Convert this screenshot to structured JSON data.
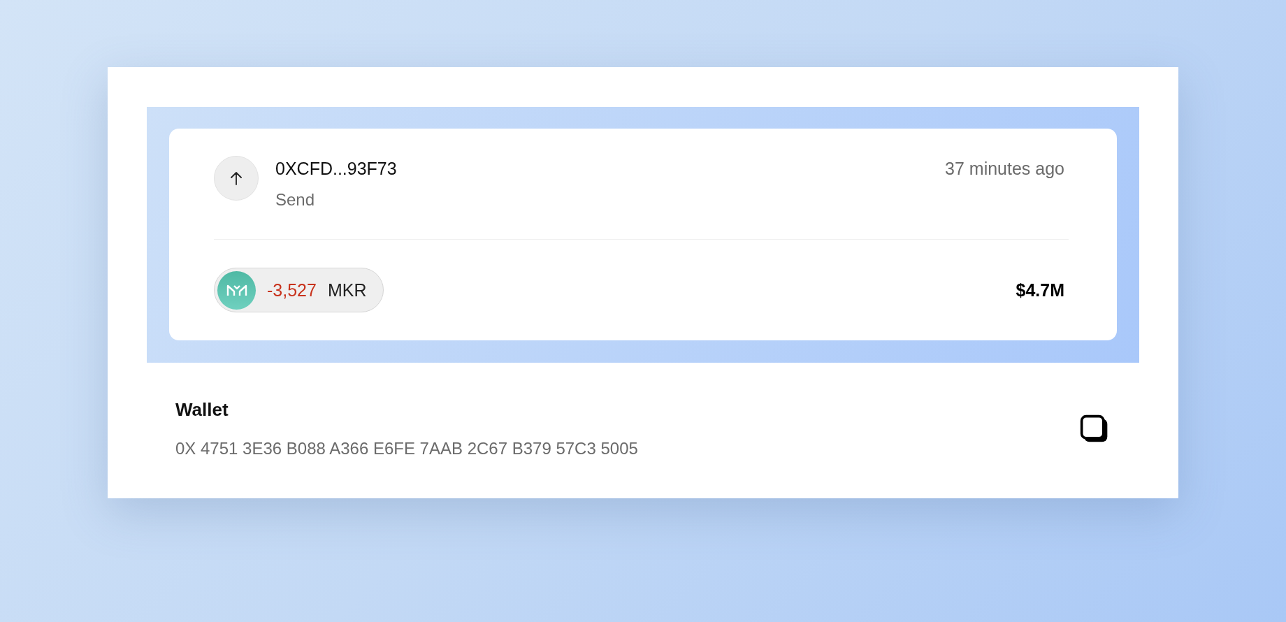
{
  "transaction": {
    "kind": "send",
    "address": "0XCFD...93F73",
    "type_label": "Send",
    "time": "37 minutes ago",
    "token": {
      "amount": "-3,527",
      "symbol": "MKR"
    },
    "value": "$4.7M"
  },
  "wallet": {
    "title": "Wallet",
    "address": "0X 4751 3E36 B088 A366 E6FE 7AAB 2C67 B379 57C3 5005"
  }
}
